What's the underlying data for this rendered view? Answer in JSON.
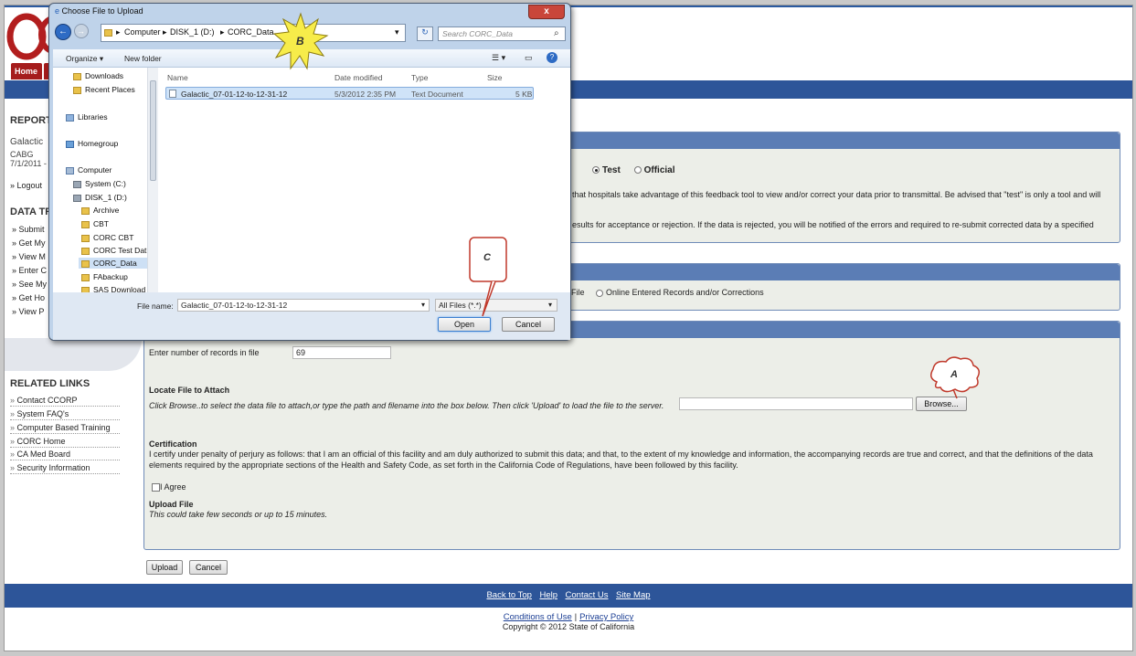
{
  "nav": {
    "home": "Home"
  },
  "sidebar": {
    "report_heading": "REPORT",
    "hospital": "Galactic",
    "program": "CABG",
    "period": "7/1/2011 -",
    "logout": "» Logout",
    "data_heading": "DATA TR",
    "items": [
      "» Submit",
      "» Get My",
      "» View M",
      "» Enter C",
      "» See My",
      "» Get Ho",
      "» View P"
    ],
    "related_heading": "RELATED LINKS",
    "related": [
      "Contact CCORP",
      "System FAQ's",
      "Computer Based Training",
      "CORC Home",
      "CA Med Board",
      "Security Information"
    ]
  },
  "submission": {
    "test_label": "Test",
    "official_label": "Official",
    "desc1": "that hospitals take advantage of this feedback tool to view and/or correct your data prior to transmittal. Be advised that \"test\" is only a tool and will",
    "desc2": "esults for acceptance or rejection. If the data is rejected, you will be notified of the errors and required to re-submit corrected data by a specified"
  },
  "method": {
    "file_tail": "File",
    "online_label": "Online Entered Records and/or Corrections"
  },
  "upload": {
    "records_label": "Enter number of records in file",
    "records_value": "69",
    "locate_heading": "Locate File to Attach",
    "locate_instr": "Click Browse..to select the data file to attach,or type the path and filename into the box below. Then click 'Upload' to load the file to the server.",
    "browse": "Browse...",
    "cert_heading": "Certification",
    "cert_text1": "I certify under penalty of perjury as follows: that I am an official of this facility and am duly authorized to submit this data; and that, to the extent of my knowledge and information, the accompanying records are true and correct, and that the definitions of the data",
    "cert_text2": "elements required by the appropriate sections of the Health and Safety Code, as set forth in the California Code of Regulations, have been followed by this facility.",
    "agree": "I Agree",
    "upload_heading": "Upload File",
    "upload_note": "This could take few seconds or up to 15 minutes.",
    "upload_btn": "Upload",
    "cancel_btn": "Cancel"
  },
  "footer": {
    "links": [
      "Back to Top",
      "Help",
      "Contact Us",
      "Site Map"
    ],
    "conditions": "Conditions of Use",
    "sep": "|",
    "privacy": "Privacy Policy",
    "copyright": "Copyright © 2012 State of California"
  },
  "dialog": {
    "title": "Choose File to Upload",
    "close": "x",
    "crumbs": [
      "Computer",
      "DISK_1 (D:)",
      "CORC_Data"
    ],
    "search_placeholder": "Search CORC_Data",
    "organize": "Organize ▾",
    "new_folder": "New folder",
    "nav_items": [
      "Downloads",
      "Recent Places",
      "Libraries",
      "Homegroup",
      "Computer",
      "System (C:)",
      "DISK_1 (D:)",
      "Archive",
      "CBT",
      "CORC CBT",
      "CORC Test Dat",
      "CORC_Data",
      "FAbackup",
      "SAS Download"
    ],
    "columns": [
      "Name",
      "Date modified",
      "Type",
      "Size"
    ],
    "file": {
      "name": "Galactic_07-01-12-to-12-31-12",
      "date": "5/3/2012 2:35 PM",
      "type": "Text Document",
      "size": "5 KB"
    },
    "filename_label": "File name:",
    "filename_value": "Galactic_07-01-12-to-12-31-12",
    "filetype": "All Files (*.*)",
    "open": "Open",
    "cancel": "Cancel"
  },
  "callouts": {
    "a": "A",
    "b": "B",
    "c": "C"
  },
  "colors": {
    "brand_blue": "#2d5599",
    "home_red": "#a51c1c",
    "panel_header": "#5b7db5",
    "callout_red": "#c0392b",
    "burst_yellow": "#f7ec4a"
  }
}
